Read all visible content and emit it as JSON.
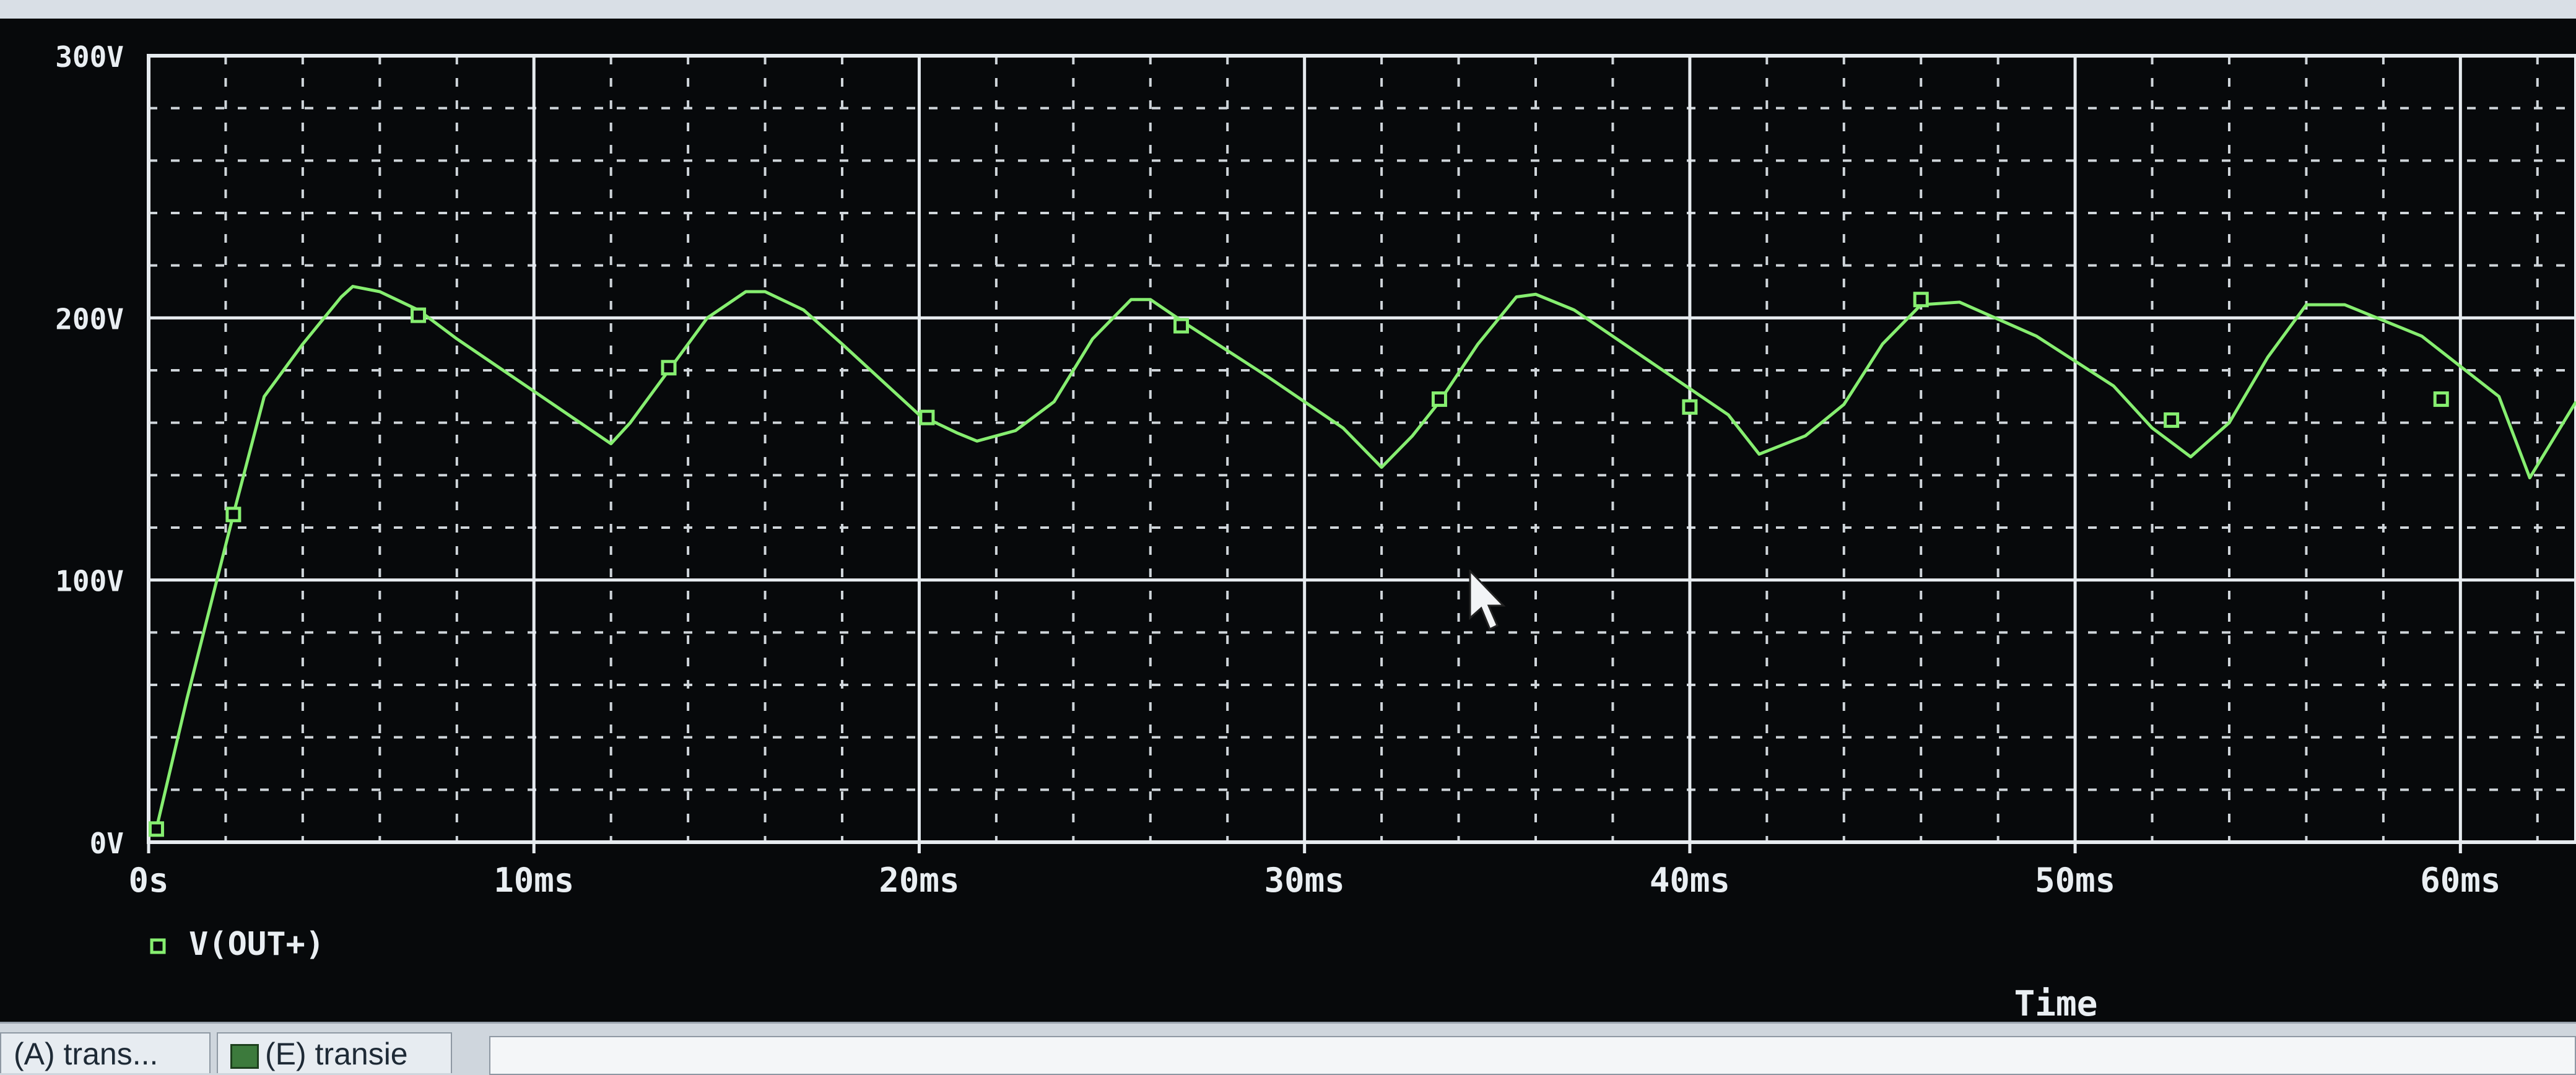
{
  "window": {
    "tabs": [
      {
        "label": "(A) trans..."
      },
      {
        "label": "(E) transie"
      }
    ]
  },
  "icons": {
    "cursor": "mouse-pointer-icon",
    "legend_marker": "square-marker-icon",
    "tab_icon": "waveform-icon"
  },
  "colors": {
    "background": "#07090b",
    "grid_major": "#e6ebef",
    "grid_minor": "#cfd5da",
    "trace": "#86ee70",
    "text": "#e9eef2"
  },
  "chart_data": {
    "type": "line",
    "xlabel": "Time",
    "ylabel": "",
    "xlim": [
      0,
      63
    ],
    "ylim": [
      0,
      300
    ],
    "x_ticks": [
      0,
      10,
      20,
      30,
      40,
      50,
      60
    ],
    "x_tick_labels": [
      "0s",
      "10ms",
      "20ms",
      "30ms",
      "40ms",
      "50ms",
      "60ms"
    ],
    "y_ticks": [
      0,
      100,
      200,
      300
    ],
    "y_tick_labels": [
      "0V",
      "100V",
      "200V",
      "300V"
    ],
    "grid": true,
    "legend_position": "bottom-left",
    "series": [
      {
        "name": "V(OUT+)",
        "color": "#86ee70",
        "x": [
          0.2,
          1.0,
          2.2,
          3.0,
          4.0,
          5.0,
          5.3,
          6.0,
          7.0,
          8.0,
          10.0,
          12.0,
          12.5,
          13.5,
          14.5,
          15.5,
          16.0,
          17.0,
          18.0,
          20.0,
          21.0,
          21.5,
          22.5,
          23.5,
          24.5,
          25.5,
          26.0,
          27.0,
          29.0,
          31.0,
          32.0,
          32.8,
          33.5,
          34.5,
          35.5,
          36.0,
          37.0,
          39.0,
          41.0,
          41.8,
          43.0,
          44.0,
          45.0,
          46.0,
          47.0,
          49.0,
          51.0,
          52.0,
          53.0,
          54.0,
          55.0,
          56.0,
          57.0,
          59.0,
          61.0,
          61.8,
          63.0
        ],
        "values": [
          5,
          55,
          125,
          170,
          190,
          208,
          212,
          210,
          203,
          192,
          172,
          152,
          160,
          180,
          200,
          210,
          210,
          203,
          190,
          163,
          156,
          153,
          157,
          168,
          192,
          207,
          207,
          197,
          178,
          158,
          143,
          155,
          168,
          190,
          208,
          209,
          203,
          183,
          163,
          148,
          155,
          167,
          190,
          205,
          206,
          193,
          174,
          158,
          147,
          160,
          185,
          205,
          205,
          193,
          170,
          139,
          168
        ],
        "markers_x": [
          0.2,
          2.2,
          7.0,
          13.5,
          20.2,
          26.8,
          33.5,
          40.0,
          46.0,
          52.5,
          59.5
        ],
        "markers_y": [
          5,
          125,
          201,
          181,
          162,
          197,
          169,
          166,
          207,
          161,
          169
        ]
      }
    ]
  }
}
